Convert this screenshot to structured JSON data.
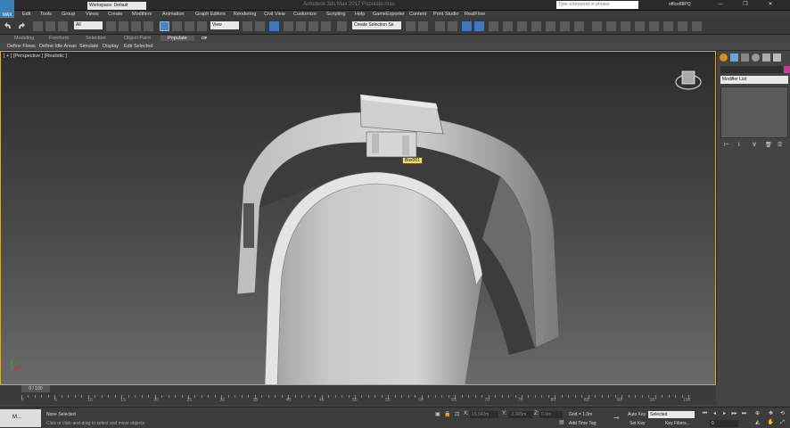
{
  "titlebar": {
    "logo_text": "MAX",
    "workspace": "Workspace: Default",
    "title": "Autodesk 3ds Max 2017   Populate.max",
    "search_placeholder": "Type a keyword or phrase",
    "user": "office88PQ",
    "window_buttons": [
      "—",
      "❐",
      "✕"
    ]
  },
  "menu": [
    "Edit",
    "Tools",
    "Group",
    "Views",
    "Create",
    "Modifiers",
    "Animation",
    "Graph Editors",
    "Rendering",
    "Civil View",
    "Customize",
    "Scripting",
    "Help",
    "GameExporter",
    "Content",
    "Print Studio",
    "RealFlow"
  ],
  "toolbar": {
    "filter": "All",
    "view": "View",
    "selection_set": "Create Selection Se"
  },
  "ribbon": {
    "tabs": [
      "Modeling",
      "Freeform",
      "Selection",
      "Object Paint",
      "Populate"
    ],
    "active_tab": "Populate",
    "items": [
      "Define Flows",
      "Define Idle Areas",
      "Simulate",
      "Display",
      "Edit Selected"
    ]
  },
  "viewport": {
    "label": "[ + ] [Perspective ] [Realistic ]",
    "object_tag": "Box001"
  },
  "command_panel": {
    "modifier_list": "Modifier List"
  },
  "timeline": {
    "frame_display": "0 / 100",
    "ticks": [
      "0",
      "5",
      "10",
      "15",
      "20",
      "25",
      "30",
      "35",
      "40",
      "45",
      "50",
      "55",
      "60",
      "65",
      "70",
      "75",
      "80",
      "85",
      "90",
      "95",
      "100"
    ]
  },
  "statusbar": {
    "script_label": "M...",
    "selection": "None Selected",
    "prompt": "Click or click-and-drag to select and move objects",
    "x_label": "X:",
    "x_value": "15.642m",
    "y_label": "Y:",
    "y_value": "-3.905m",
    "z_label": "Z:",
    "z_value": "0.0m",
    "grid": "Grid = 1.0m",
    "add_time_tag": "Add Time Tag",
    "auto_key": "Auto Key",
    "set_key": "Set Key",
    "key_mode": "Selected",
    "key_filters": "Key Filters...",
    "current_frame": "0"
  }
}
